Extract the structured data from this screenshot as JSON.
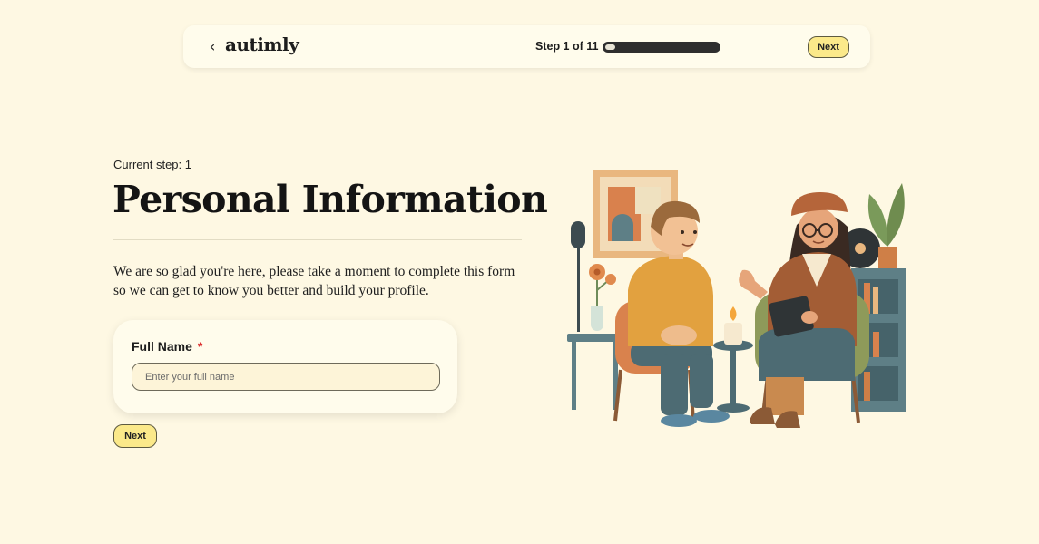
{
  "header": {
    "back_icon": "chevron-left-icon",
    "logo": "autimly",
    "step_label": "Step 1 of 11",
    "progress": 0.091,
    "next_label": "Next"
  },
  "main": {
    "current_step": "Current step: 1",
    "title": "Personal Information",
    "intro": "We are so glad you're here, please take a moment to complete this form so we can get to know you better and build your profile.",
    "form": {
      "full_name_label": "Full Name",
      "required_mark": "*",
      "full_name_value": "",
      "full_name_placeholder": "Enter your full name"
    },
    "next_label": "Next"
  },
  "colors": {
    "background": "#fef8e3",
    "card": "#fffcec",
    "button": "#fbe98a",
    "required": "#dd3333"
  }
}
